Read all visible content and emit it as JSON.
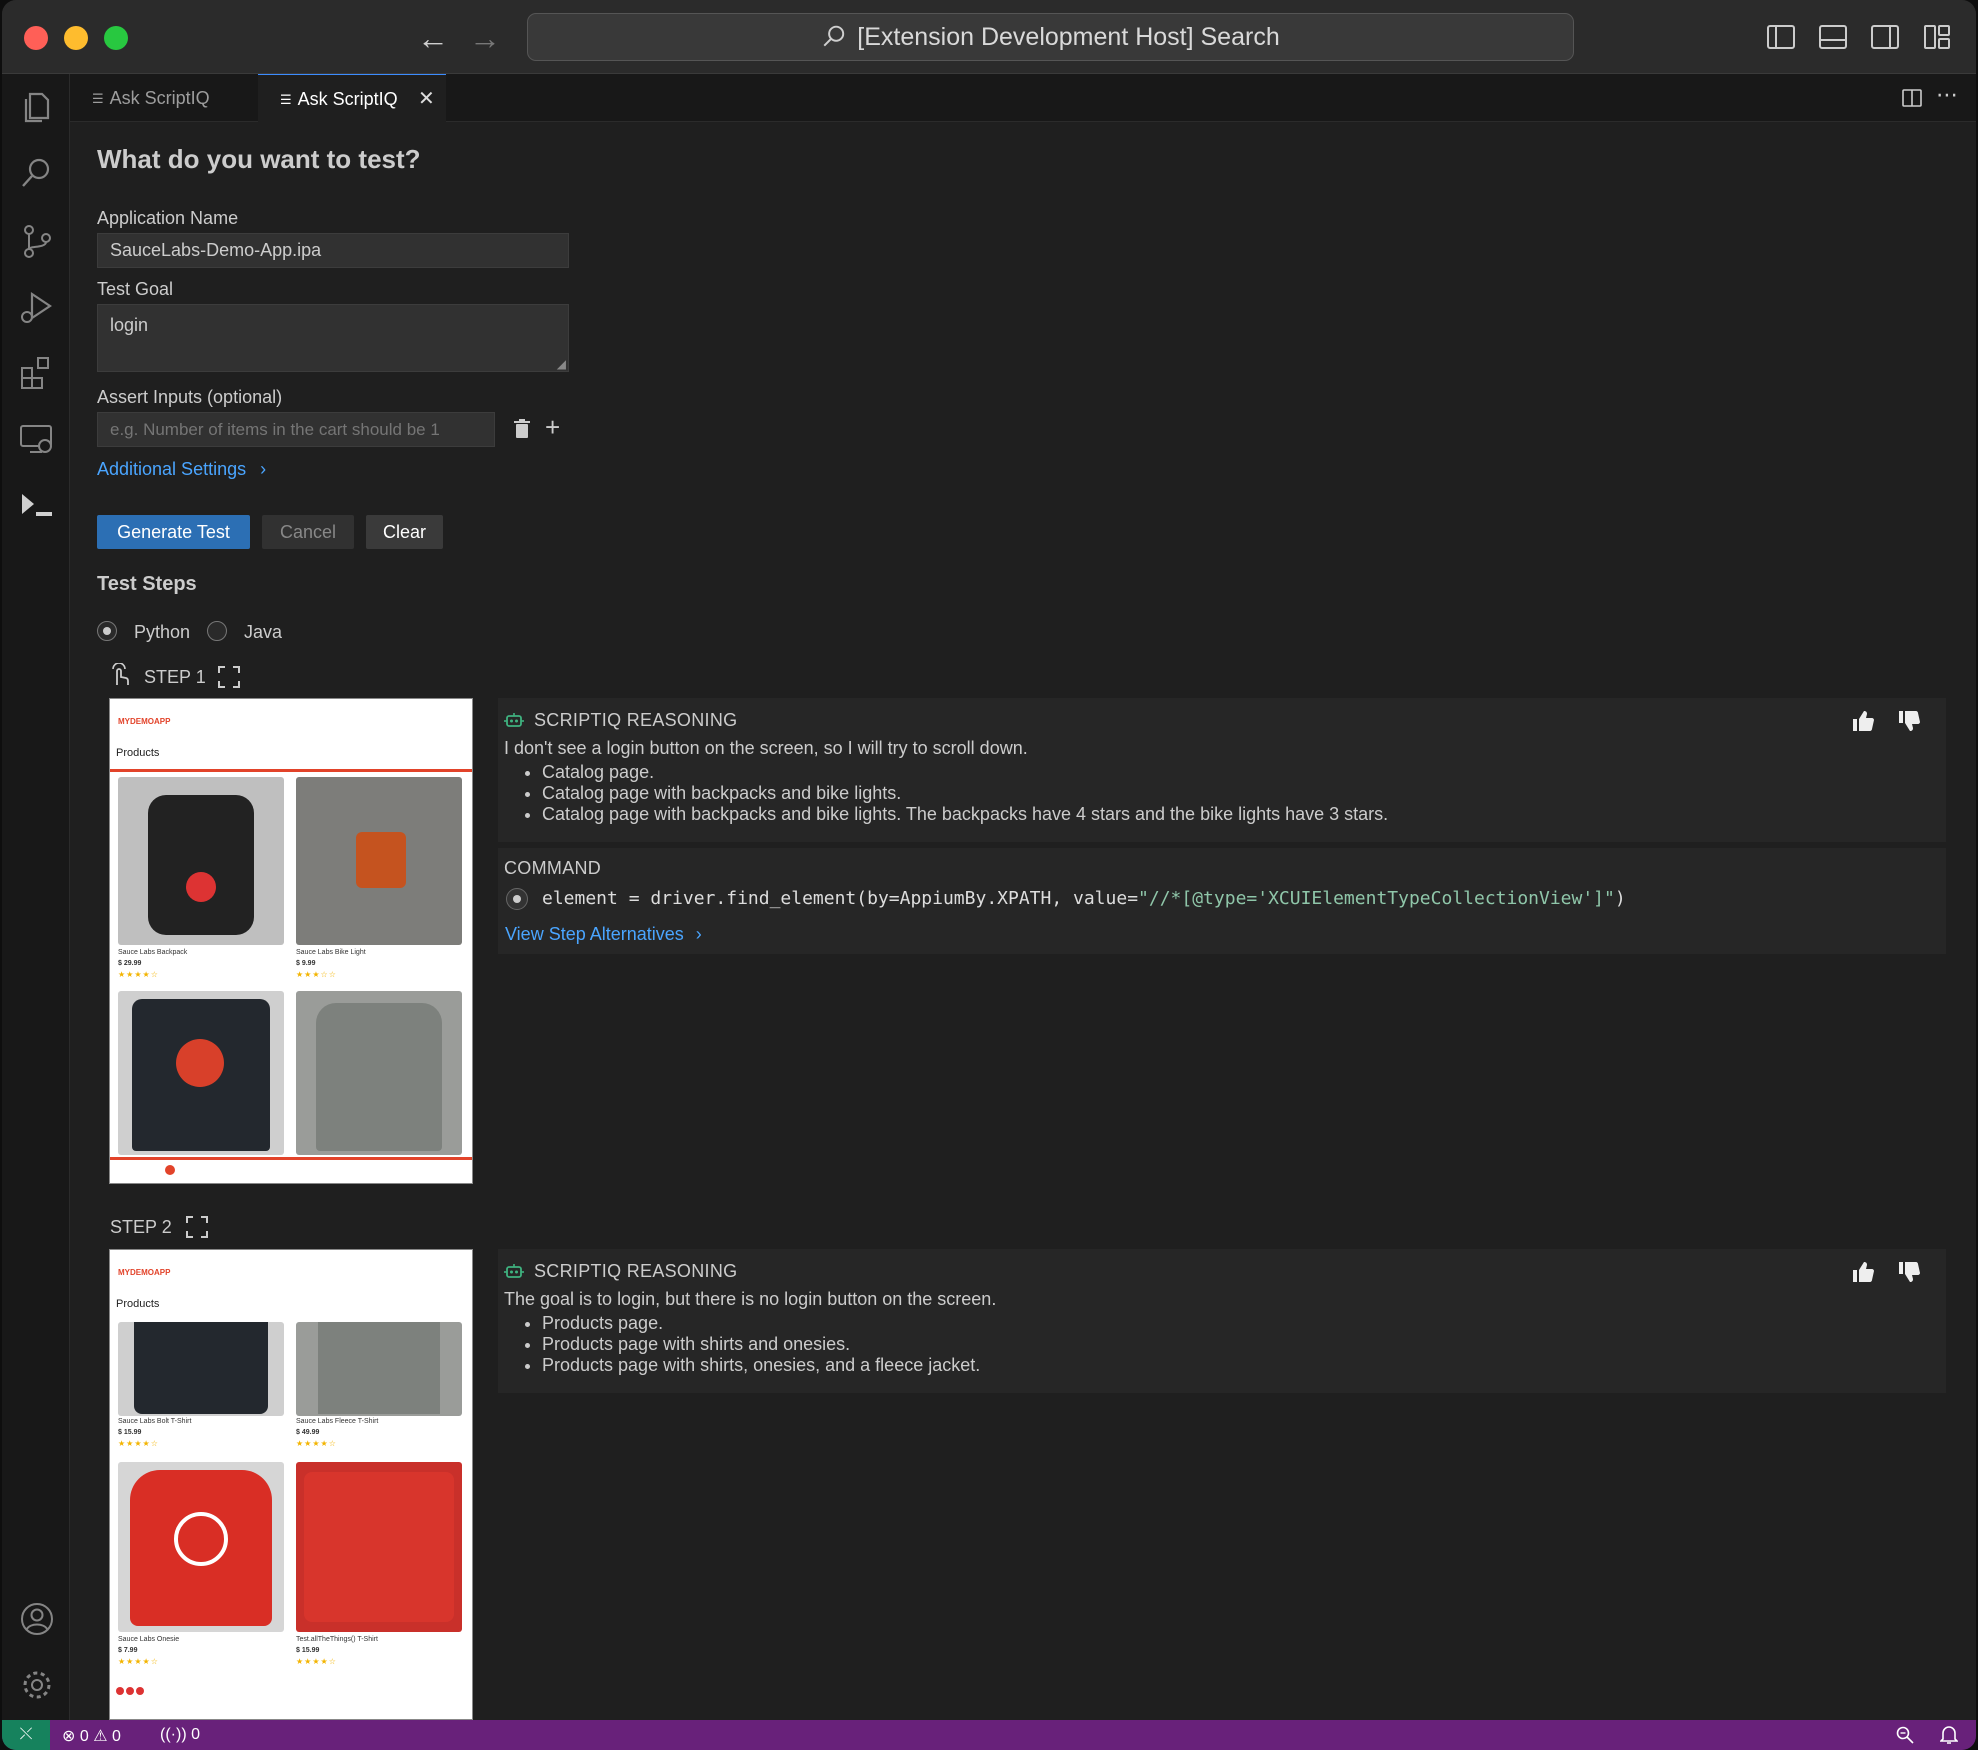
{
  "window": {
    "search_text": "[Extension Development Host] Search"
  },
  "tabs": [
    {
      "label": "Ask ScriptIQ",
      "active": false
    },
    {
      "label": "Ask ScriptIQ",
      "active": true
    }
  ],
  "form": {
    "heading": "What do you want to test?",
    "app_name_label": "Application Name",
    "app_name_value": "SauceLabs-Demo-App.ipa",
    "test_goal_label": "Test Goal",
    "test_goal_value": "login",
    "assert_label": "Assert Inputs (optional)",
    "assert_placeholder": "e.g. Number of items in the cart should be 1",
    "additional_settings": "Additional Settings",
    "generate_label": "Generate Test",
    "cancel_label": "Cancel",
    "clear_label": "Clear"
  },
  "steps_section": {
    "heading": "Test Steps",
    "languages": [
      {
        "label": "Python",
        "selected": true
      },
      {
        "label": "Java",
        "selected": false
      }
    ]
  },
  "steps": [
    {
      "title": "STEP 1",
      "reasoning_header": "SCRIPTIQ REASONING",
      "reasoning": "I don't see a login button on the screen, so I will try to scroll down.",
      "bullets": [
        "Catalog page.",
        "Catalog page with backpacks and bike lights.",
        "Catalog page with backpacks and bike lights. The backpacks have 4 stars and the bike lights have 3 stars."
      ],
      "command_header": "COMMAND",
      "command_code": "element = driver.find_element(by=AppiumBy.XPATH, value=",
      "command_string": "\"//*[@type='XCUIElementTypeCollectionView']\"",
      "command_close": ")",
      "alternatives_label": "View Step Alternatives",
      "screenshot": {
        "app_logo": "MYDEMOAPP",
        "page_title": "Products",
        "products": [
          {
            "caption": "Sauce Labs Backpack",
            "price": "$ 29.99"
          },
          {
            "caption": "Sauce Labs Bike Light",
            "price": "$ 9.99"
          }
        ]
      }
    },
    {
      "title": "STEP 2",
      "reasoning_header": "SCRIPTIQ REASONING",
      "reasoning": "The goal is to login, but there is no login button on the screen.",
      "bullets": [
        "Products page.",
        "Products page with shirts and onesies.",
        "Products page with shirts, onesies, and a fleece jacket."
      ],
      "screenshot": {
        "app_logo": "MYDEMOAPP",
        "page_title": "Products",
        "products": [
          {
            "caption": "Sauce Labs Bolt T-Shirt",
            "price": "$ 15.99"
          },
          {
            "caption": "Sauce Labs Fleece T-Shirt",
            "price": "$ 49.99"
          },
          {
            "caption": "Sauce Labs Onesie",
            "price": "$ 7.99"
          },
          {
            "caption": "Test.allTheThings() T-Shirt",
            "price": "$ 15.99"
          }
        ]
      }
    }
  ],
  "status_bar": {
    "errors": "0",
    "warnings": "0",
    "ports": "0"
  },
  "colors": {
    "accent": "#2c6fb4",
    "link": "#4aa5ff",
    "status_bar": "#68217a",
    "code_string": "#ce9178"
  }
}
